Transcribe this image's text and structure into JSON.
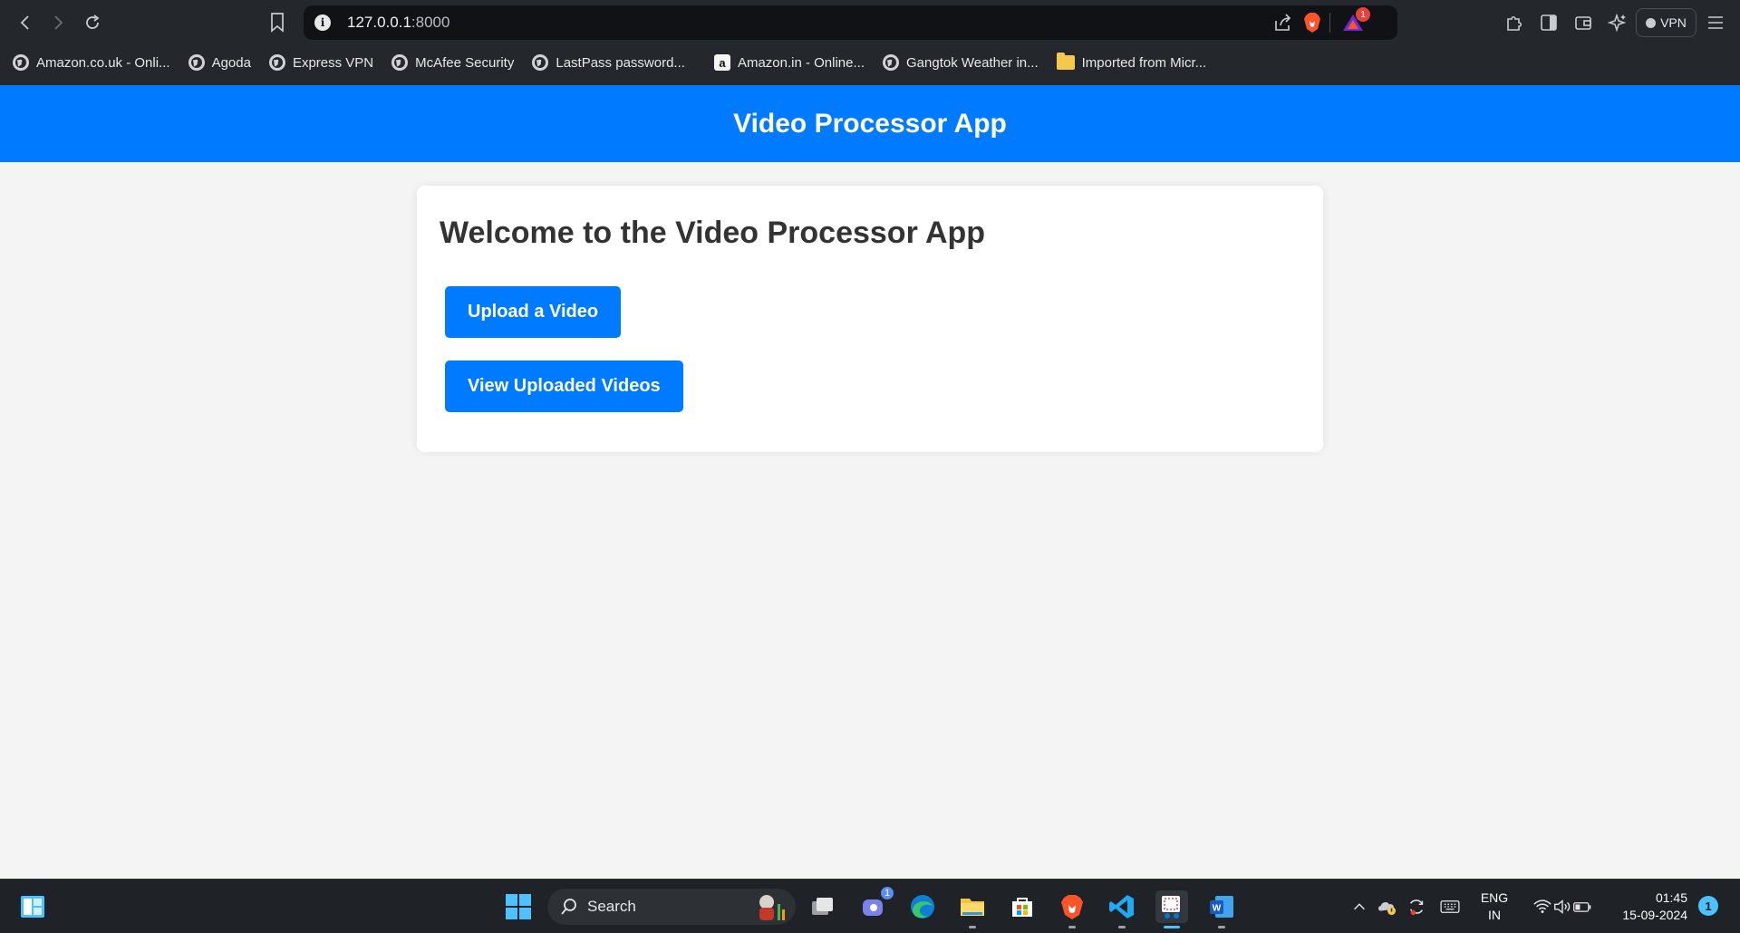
{
  "browser": {
    "url_host": "127.0.0.1",
    "url_port": ":8000",
    "vpn_label": "VPN",
    "brave_rewards_badge": "1",
    "bookmarks": [
      {
        "label": "Amazon.co.uk - Onli...",
        "icon": "globe-icon"
      },
      {
        "label": "Agoda",
        "icon": "globe-icon"
      },
      {
        "label": "Express VPN",
        "icon": "globe-icon"
      },
      {
        "label": "McAfee Security",
        "icon": "globe-icon"
      },
      {
        "label": "LastPass password...",
        "icon": "globe-icon"
      },
      {
        "label": "Amazon.in - Online...",
        "icon": "amazon-icon"
      },
      {
        "label": "Gangtok Weather in...",
        "icon": "globe-icon"
      },
      {
        "label": "Imported from Micr...",
        "icon": "folder-icon"
      }
    ]
  },
  "app": {
    "header_title": "Video Processor App",
    "welcome_heading": "Welcome to the Video Processor App",
    "upload_button": "Upload a Video",
    "view_button": "View Uploaded Videos"
  },
  "taskbar": {
    "search_label": "Search",
    "teams_badge": "1",
    "lang_line1": "ENG",
    "lang_line2": "IN",
    "time": "01:45",
    "date": "15-09-2024",
    "notification_count": "1"
  },
  "colors": {
    "primary": "#007bff",
    "chrome": "#24272c",
    "taskbar": "#1f2328"
  }
}
